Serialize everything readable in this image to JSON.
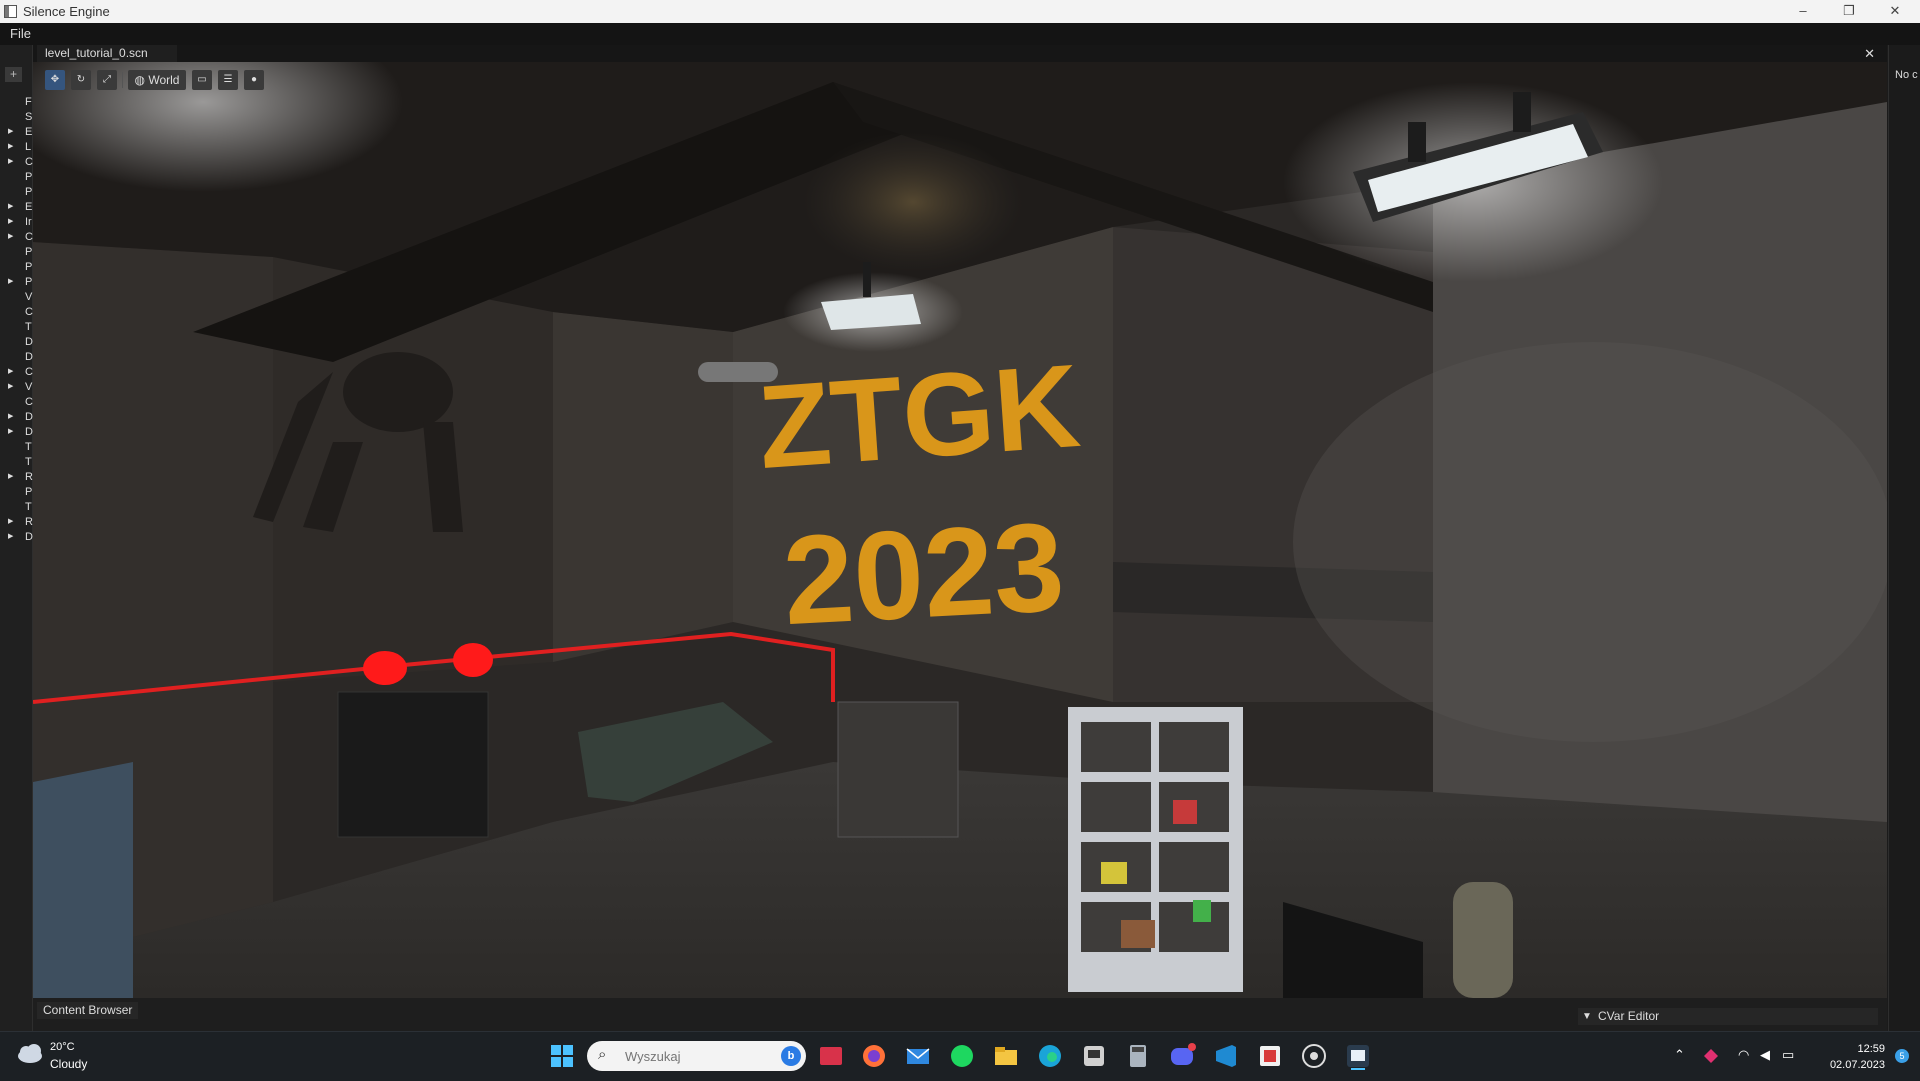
{
  "window": {
    "title": "Silence Engine",
    "minimize": "–",
    "restore": "❐",
    "close": "✕"
  },
  "menu": {
    "file": "File"
  },
  "scene_tab": {
    "label": "level_tutorial_0.scn",
    "close": "✕"
  },
  "hierarchy": {
    "add_label": "+",
    "items": [
      {
        "label": "F",
        "expandable": false
      },
      {
        "label": "S",
        "expandable": false
      },
      {
        "label": "E",
        "expandable": true
      },
      {
        "label": "L",
        "expandable": true
      },
      {
        "label": "C",
        "expandable": true
      },
      {
        "label": "P",
        "expandable": false
      },
      {
        "label": "P",
        "expandable": false
      },
      {
        "label": "E",
        "expandable": true
      },
      {
        "label": "Ir",
        "expandable": true
      },
      {
        "label": "C",
        "expandable": true
      },
      {
        "label": "P",
        "expandable": false
      },
      {
        "label": "P",
        "expandable": false
      },
      {
        "label": "P",
        "expandable": true
      },
      {
        "label": "V",
        "expandable": false
      },
      {
        "label": "C",
        "expandable": false
      },
      {
        "label": "T",
        "expandable": false
      },
      {
        "label": "D",
        "expandable": false
      },
      {
        "label": "D",
        "expandable": false
      },
      {
        "label": "C",
        "expandable": true
      },
      {
        "label": "V",
        "expandable": true
      },
      {
        "label": "C",
        "expandable": false
      },
      {
        "label": "D",
        "expandable": true
      },
      {
        "label": "D",
        "expandable": true
      },
      {
        "label": "T",
        "expandable": false
      },
      {
        "label": "T",
        "expandable": false
      },
      {
        "label": "R",
        "expandable": true
      },
      {
        "label": "P",
        "expandable": false
      },
      {
        "label": "T",
        "expandable": false
      },
      {
        "label": "R",
        "expandable": true
      },
      {
        "label": "D",
        "expandable": true
      }
    ]
  },
  "viewport_toolbar": {
    "translate": "✥",
    "rotate": "↻",
    "scale": "⤢",
    "space_label": "World",
    "tool_a": "▭",
    "tool_b": "☰",
    "tool_c": "●"
  },
  "scene_text": {
    "line1": "ZTGK",
    "line2": "2023"
  },
  "right_panel": {
    "clipped_text": "No c"
  },
  "bottom": {
    "content_browser": "Content Browser",
    "cvar_editor": "CVar Editor"
  },
  "taskbar": {
    "weather_temp": "20°C",
    "weather_cond": "Cloudy",
    "search_placeholder": "Wyszukaj",
    "time": "12:59",
    "date": "02.07.2023",
    "notifications": "5"
  },
  "colors": {
    "accent": "#35557e",
    "laser": "#e02020",
    "wall_text": "#d9961a"
  }
}
